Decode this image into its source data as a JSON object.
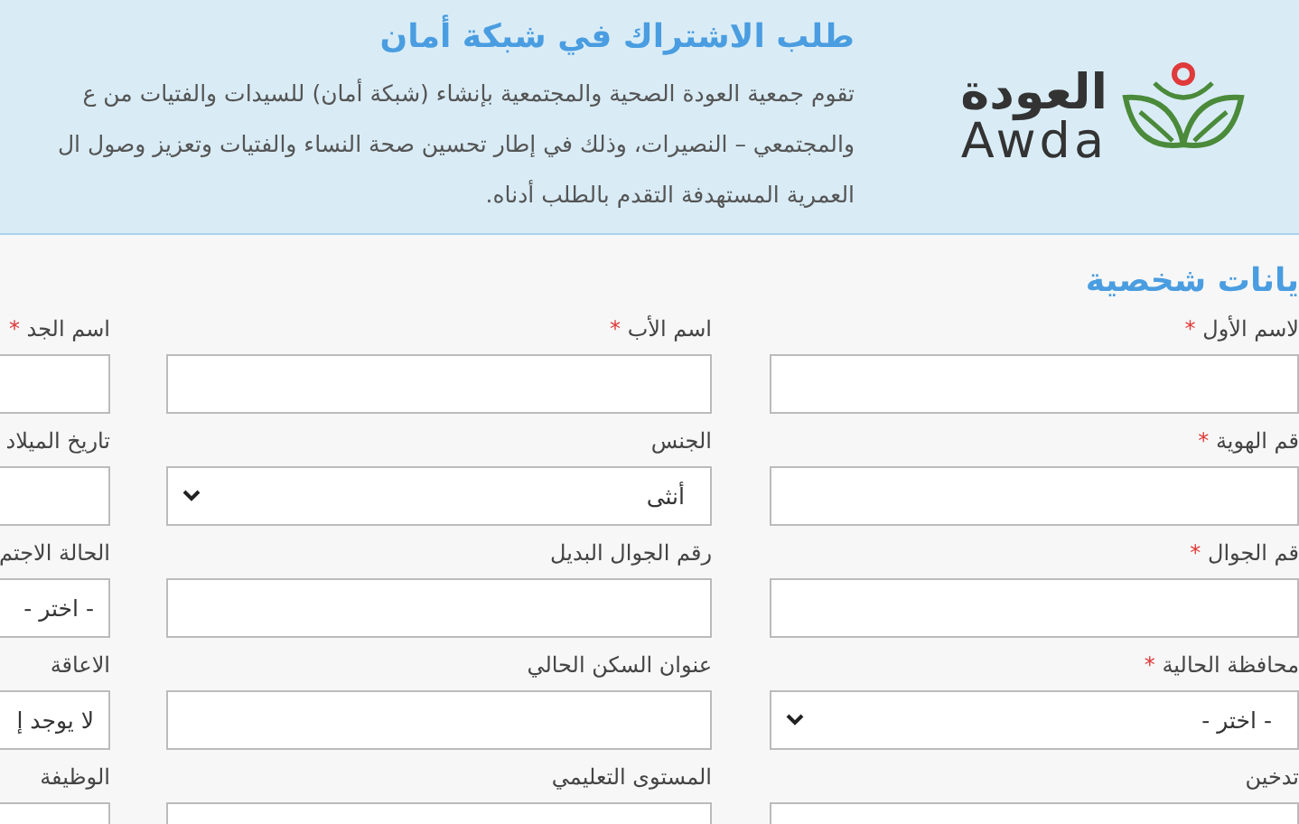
{
  "header": {
    "logo": {
      "arabic": "العودة",
      "latin": "Awda"
    },
    "title": "طلب الاشتراك في شبكة أمان",
    "intro_lines": [
      "تقوم جمعية العودة الصحية والمجتمعية بإنشاء (شبكة أمان) للسيدات والفتيات من ع",
      "والمجتمعي – النصيرات، وذلك في إطار تحسين صحة النساء والفتيات وتعزيز وصول ال",
      "العمرية المستهدفة التقدم بالطلب أدناه."
    ]
  },
  "section_title": "يانات شخصية",
  "fields": [
    {
      "label": "لاسم الأول",
      "required_mark": "*",
      "kind": "text"
    },
    {
      "label": "اسم الأب",
      "required_mark": "*",
      "kind": "text"
    },
    {
      "label": "اسم الجد",
      "required_mark": "*",
      "kind": "text"
    },
    {
      "label": "قم الهوية",
      "required_mark": "*",
      "kind": "text"
    },
    {
      "label": "الجنس",
      "kind": "select",
      "value": "أنثى"
    },
    {
      "label": "تاريخ الميلاد",
      "kind": "text"
    },
    {
      "label": "قم الجوال",
      "required_mark": "*",
      "kind": "text"
    },
    {
      "label": "رقم الجوال البديل",
      "kind": "text"
    },
    {
      "label": "الحالة الاجتم",
      "kind": "value",
      "value": "- اختر -"
    },
    {
      "label": "محافظة الحالية",
      "required_mark": "*",
      "kind": "select",
      "value": "- اختر -"
    },
    {
      "label": "عنوان السكن الحالي",
      "kind": "text"
    },
    {
      "label": "الاعاقة",
      "kind": "value",
      "value": "لا يوجد إ"
    },
    {
      "label": "تدخين",
      "kind": "text"
    },
    {
      "label": "المستوى التعليمي",
      "kind": "text"
    },
    {
      "label": "الوظيفة",
      "kind": "text"
    }
  ]
}
